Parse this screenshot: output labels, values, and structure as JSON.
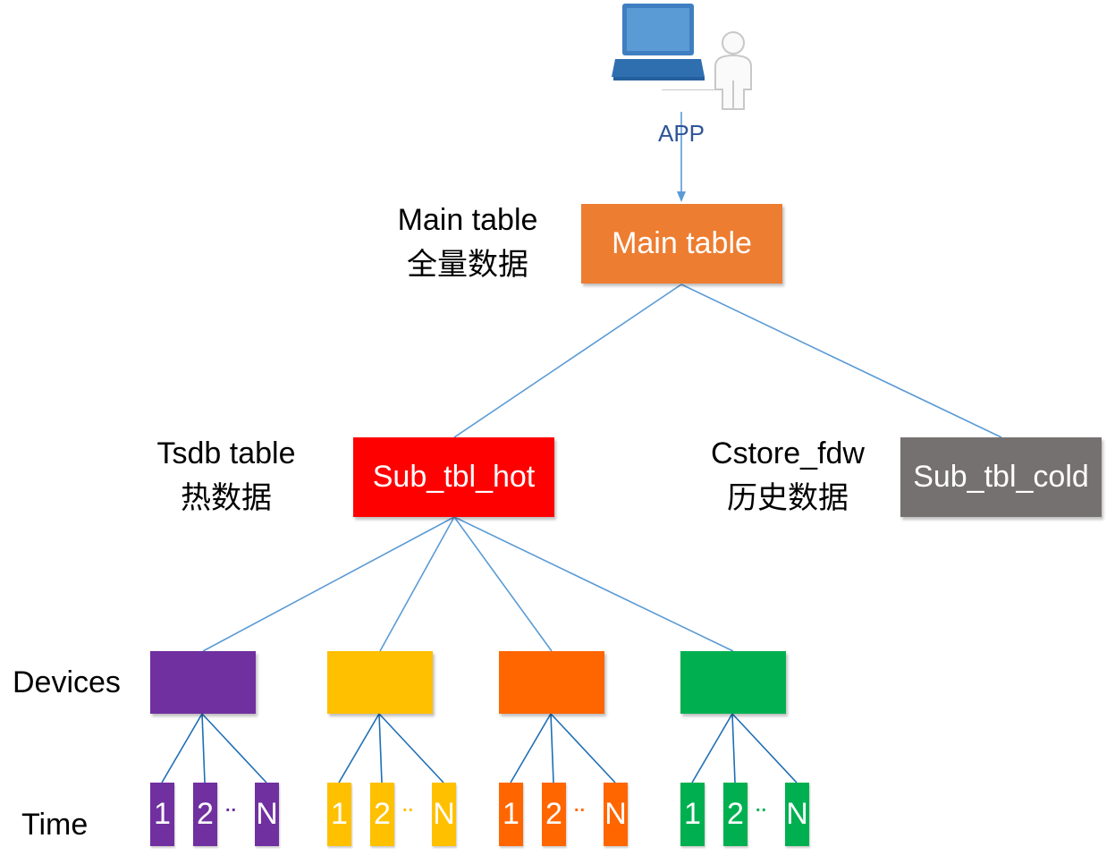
{
  "app": {
    "label": "APP",
    "computer_icon": "laptop-icon",
    "user_icon": "user-icon"
  },
  "main_table": {
    "box_label": "Main table",
    "side_label_1": "Main table",
    "side_label_2": "全量数据",
    "color": "#ed7d31"
  },
  "hot": {
    "box_label": "Sub_tbl_hot",
    "side_label_1": "Tsdb table",
    "side_label_2": "热数据",
    "color": "#ff0000"
  },
  "cold": {
    "box_label": "Sub_tbl_cold",
    "side_label_1": "Cstore_fdw",
    "side_label_2": "历史数据",
    "color": "#767171"
  },
  "rows": {
    "devices_label": "Devices",
    "time_label": "Time"
  },
  "devices": [
    {
      "color": "#7030a0",
      "leaves": [
        "1",
        "2",
        "N"
      ],
      "dots": ".."
    },
    {
      "color": "#ffc000",
      "leaves": [
        "1",
        "2",
        "N"
      ],
      "dots": ".."
    },
    {
      "color": "#ff6600",
      "leaves": [
        "1",
        "2",
        "N"
      ],
      "dots": ".."
    },
    {
      "color": "#00b050",
      "leaves": [
        "1",
        "2",
        "N"
      ],
      "dots": ".."
    }
  ],
  "line_color": "#5b9bd5",
  "leaf_line_color": "#1f6fb4"
}
